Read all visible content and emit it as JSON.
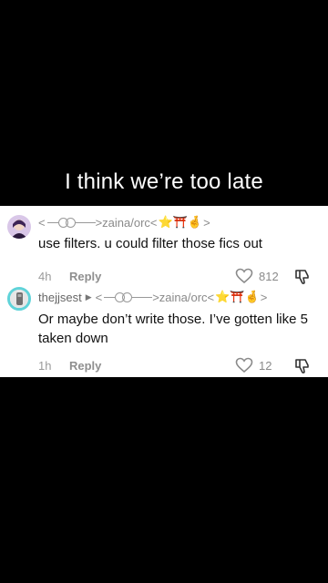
{
  "caption": "I think we’re too late",
  "comments": [
    {
      "username": "",
      "name_suffix": ">zaina/orc<",
      "name_prefix": "<",
      "name_end": ">",
      "text": "use filters. u could filter those fics out",
      "time": "4h",
      "reply_label": "Reply",
      "likes": "812",
      "emojis": "⭐⛩️🤞"
    },
    {
      "username": "thejjsest",
      "name_suffix": ">zaina/orc<",
      "name_prefix": "<",
      "name_end": ">",
      "text": "Or maybe don’t write those. I’ve gotten like 5 taken down",
      "time": "1h",
      "reply_label": "Reply",
      "likes": "12",
      "emojis": "⭐⛩️🤞"
    }
  ],
  "colors": {
    "background": "#000000",
    "card": "#ffffff",
    "story_ring": "#5fd3d9"
  }
}
